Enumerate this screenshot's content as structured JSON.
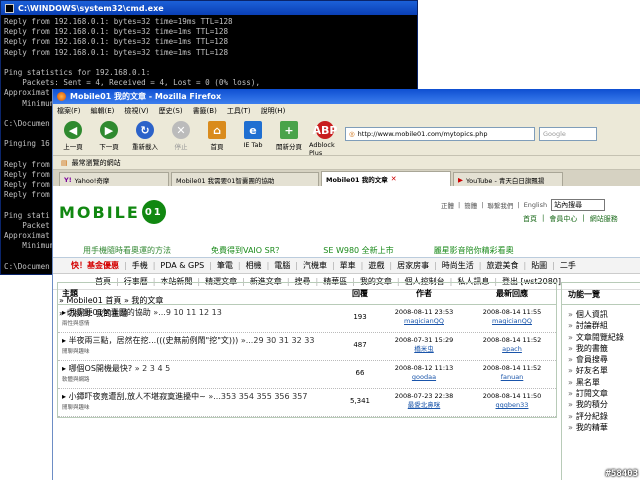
{
  "cmd": {
    "title": "C:\\WINDOWS\\system32\\cmd.exe",
    "lines": [
      "Reply from 192.168.0.1: bytes=32 time=19ms TTL=128",
      "Reply from 192.168.0.1: bytes=32 time=1ms TTL=128",
      "Reply from 192.168.0.1: bytes=32 time=1ms TTL=128",
      "Reply from 192.168.0.1: bytes=32 time=1ms TTL=128",
      "",
      "Ping statistics for 192.168.0.1:",
      "    Packets: Sent = 4, Received = 4, Lost = 0 (0% loss),",
      "Approximat",
      "    Minimum",
      "",
      "C:\\Documen",
      "",
      "Pinging 16",
      "",
      "Reply from",
      "Reply from",
      "Reply from",
      "Reply from",
      "",
      "Ping stati",
      "    Packet",
      "Approximat",
      "    Minimum",
      "",
      "C:\\Documen"
    ]
  },
  "browser": {
    "title": "Mobile01 我的文章 - Mozilla Firefox",
    "menu": [
      "檔案(F)",
      "編輯(E)",
      "檢視(V)",
      "歷史(S)",
      "書籤(B)",
      "工具(T)",
      "說明(H)"
    ],
    "nav": {
      "back": "上一頁",
      "forward": "下一頁",
      "reload": "重新載入",
      "stop": "停止",
      "home": "首頁",
      "ietab": "IE Tab",
      "newtab": "開新分頁",
      "adblock": "Adblock Plus"
    },
    "url": "http://www.mobile01.com/mytopics.php",
    "search_placeholder": "Google",
    "bookmark": "最常瀏覽的網站",
    "tabs": [
      "Yahoo!奇摩",
      "Mobile01 我需要01智囊團的協助",
      "Mobile01 我的文章",
      "YouTube - 青天白日旗飄揚"
    ]
  },
  "site": {
    "logo": "MOBILE",
    "toplinks": [
      "正體",
      "簡體",
      "聯繫我們",
      "English"
    ],
    "search_value": "站內搜尋",
    "toplinks2": [
      "首頁",
      "會員中心",
      "網站服務"
    ],
    "promos": [
      "用手機隨時看奧運的方法",
      "免費得到VAIO SR？",
      "SE W980 全新上市",
      "麗星影音陪你精彩看奧"
    ],
    "categories": [
      "快！基金優惠",
      "手機",
      "PDA & GPS",
      "筆電",
      "相機",
      "電腦",
      "汽機車",
      "單車",
      "遊戲",
      "居家房事",
      "時尚生活",
      "旅遊美食",
      "貼圖",
      "二手"
    ],
    "subnav": [
      "首頁",
      "行事曆",
      "本站新聞",
      "精選文章",
      "新進文章",
      "搜尋",
      "精華區",
      "我的文章",
      "個人控制台",
      "私人訊息",
      "登出 [wst2080]"
    ],
    "breadcrumb": "» Mobile01 首頁 » 我的文章",
    "switch": "» 切換到: 我的主題"
  },
  "threads": {
    "headers": [
      "主題",
      "回覆",
      "作者",
      "最新回應"
    ],
    "rows": [
      {
        "title": "我需要01智囊團的協助",
        "pages": "»...9 10 11 12 13",
        "forum": "兩性與感情",
        "replies": "193",
        "author_date": "2008-08-11 23:53",
        "author": "magicianQQ",
        "last_date": "2008-08-14 11:55",
        "last_user": "magicianQQ"
      },
      {
        "title": "半夜兩三點，居然在挖...(((史無前例鬧\"挖\"文)))",
        "pages": "»...29 30 31 32 33",
        "forum": "閒聊與趣味",
        "replies": "487",
        "author_date": "2008-07-31 15:29",
        "author": "橋米虫",
        "last_date": "2008-08-14 11:52",
        "last_user": "apach"
      },
      {
        "title": "哪個OS開機最快?",
        "pages": "» 2 3 4 5",
        "forum": "軟體與網路",
        "replies": "66",
        "author_date": "2008-08-12 11:13",
        "author": "goodaa",
        "last_date": "2008-08-14 11:52",
        "last_user": "fanuan"
      },
      {
        "title": "小鐔吓夜竟遭刮,放人不堪寂寞進擾中~",
        "pages": "»...353 354 355 356 357",
        "forum": "閒聊與趣味",
        "replies": "5,341",
        "author_date": "2008-07-23 22:38",
        "author": "最愛北鼻咪",
        "last_date": "2008-08-14 11:50",
        "last_user": "qqqben33"
      }
    ]
  },
  "sidebar": {
    "title": "功能一覽",
    "items": [
      "個人資訊",
      "討論群組",
      "文章閱覽紀錄",
      "我的書籤",
      "會員搜尋",
      "好友名單",
      "黑名單",
      "訂閱文章",
      "我的積分",
      "評分紀錄",
      "我的精華"
    ]
  },
  "watermark": "#58403"
}
